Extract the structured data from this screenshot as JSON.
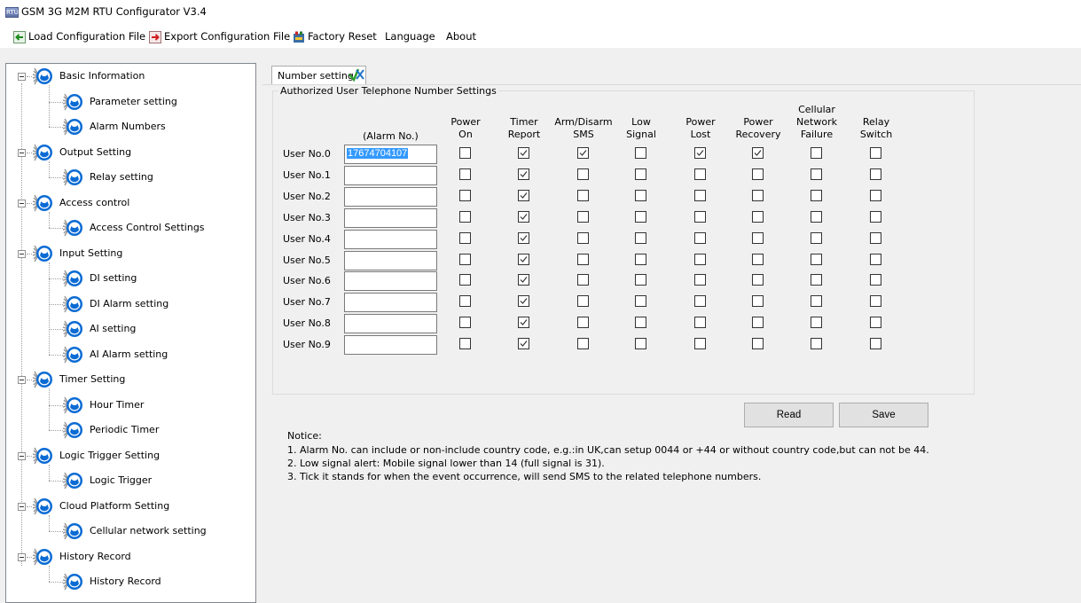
{
  "window": {
    "title": "GSM 3G M2M RTU Configurator V3.4",
    "icon": "app-icon"
  },
  "menu": [
    {
      "label": "Load Configuration File",
      "icon": "load-arrow-icon"
    },
    {
      "label": "Export Configuration File",
      "icon": "export-arrow-icon"
    },
    {
      "label": "Factory Reset",
      "icon": "factory-reset-icon"
    },
    {
      "label": "Language"
    },
    {
      "label": "About"
    }
  ],
  "tree": [
    {
      "label": "Basic Information",
      "children": [
        "Parameter setting",
        "Alarm Numbers"
      ]
    },
    {
      "label": "Output Setting",
      "children": [
        "Relay setting"
      ]
    },
    {
      "label": "Access control",
      "children": [
        "Access Control Settings"
      ]
    },
    {
      "label": "Input Setting",
      "children": [
        "DI setting",
        "DI Alarm setting",
        "AI setting",
        "AI Alarm setting"
      ]
    },
    {
      "label": "Timer Setting",
      "children": [
        "Hour Timer",
        "Periodic Timer"
      ]
    },
    {
      "label": "Logic Trigger Setting",
      "children": [
        "Logic Trigger"
      ]
    },
    {
      "label": "Cloud Platform Setting",
      "children": [
        "Cellular network setting"
      ]
    },
    {
      "label": "History Record",
      "children": [
        "History Record"
      ]
    }
  ],
  "tab": {
    "label": "Number setting"
  },
  "group": {
    "title": "Authorized User Telephone Number Settings",
    "number_header": "(Alarm No.)",
    "columns": [
      [
        "Power",
        "On"
      ],
      [
        "Timer",
        "Report"
      ],
      [
        "Arm/Disarm",
        "SMS"
      ],
      [
        "Low",
        "Signal"
      ],
      [
        "Power",
        "Lost"
      ],
      [
        "Power",
        "Recovery"
      ],
      [
        "Cellular",
        "Network",
        "Failure"
      ],
      [
        "Relay",
        "Switch"
      ]
    ],
    "users": [
      {
        "label": "User No.0",
        "number": "17674704107",
        "checks": [
          false,
          true,
          true,
          false,
          true,
          true,
          false,
          false
        ]
      },
      {
        "label": "User No.1",
        "number": "",
        "checks": [
          false,
          true,
          false,
          false,
          false,
          false,
          false,
          false
        ]
      },
      {
        "label": "User No.2",
        "number": "",
        "checks": [
          false,
          true,
          false,
          false,
          false,
          false,
          false,
          false
        ]
      },
      {
        "label": "User No.3",
        "number": "",
        "checks": [
          false,
          true,
          false,
          false,
          false,
          false,
          false,
          false
        ]
      },
      {
        "label": "User No.4",
        "number": "",
        "checks": [
          false,
          true,
          false,
          false,
          false,
          false,
          false,
          false
        ]
      },
      {
        "label": "User No.5",
        "number": "",
        "checks": [
          false,
          true,
          false,
          false,
          false,
          false,
          false,
          false
        ]
      },
      {
        "label": "User No.6",
        "number": "",
        "checks": [
          false,
          true,
          false,
          false,
          false,
          false,
          false,
          false
        ]
      },
      {
        "label": "User No.7",
        "number": "",
        "checks": [
          false,
          true,
          false,
          false,
          false,
          false,
          false,
          false
        ]
      },
      {
        "label": "User No.8",
        "number": "",
        "checks": [
          false,
          true,
          false,
          false,
          false,
          false,
          false,
          false
        ]
      },
      {
        "label": "User No.9",
        "number": "",
        "checks": [
          false,
          true,
          false,
          false,
          false,
          false,
          false,
          false
        ]
      }
    ]
  },
  "buttons": {
    "read": "Read",
    "save": "Save"
  },
  "notice": {
    "title": "Notice:",
    "lines": [
      "1. Alarm No. can include or non-include country code, e.g.:in UK,can setup 0044 or +44 or without country code,but can not be 44.",
      "2. Low signal alert: Mobile signal lower than 14 (full signal is 31).",
      "3. Tick it stands for when the event occurrence, will send SMS to the related telephone numbers."
    ]
  }
}
